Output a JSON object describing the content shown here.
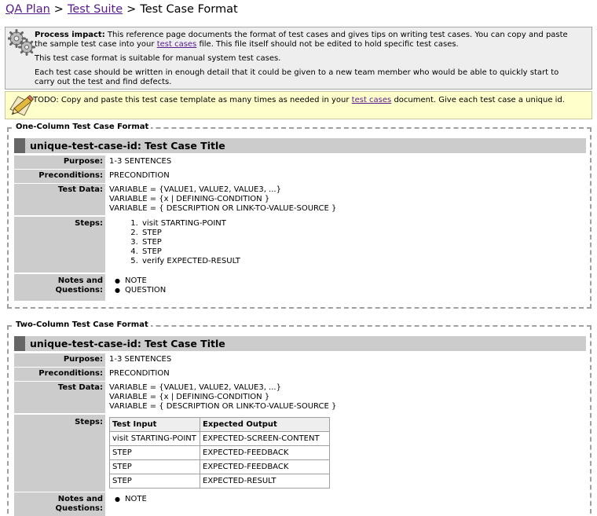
{
  "breadcrumb": {
    "link1": "QA Plan",
    "sep1": ">",
    "link2": "Test Suite",
    "sep2": ">",
    "current": "Test Case Format"
  },
  "impact": {
    "bold": "Process impact:",
    "text1": "This reference page documents the format of test cases and gives tips on writing test cases. You can copy and paste the sample test case into your",
    "link": "test cases",
    "text2": "file. This file itself should not be edited to hold specific test cases.",
    "para2": "This test case format is suitable for manual system test cases.",
    "para3": "Each test case should be written in enough detail that it could be given to a new team member who would be able to quickly start to carry out the test and find defects."
  },
  "todo": {
    "text1": "TODO: Copy and paste this test case template as many times as needed in your",
    "link": "test cases",
    "text2": "document. Give each test case a unique id."
  },
  "one_column": {
    "legend": "One-Column Test Case Format",
    "title": "unique-test-case-id: Test Case Title",
    "purpose_label": "Purpose:",
    "purpose": "1-3 SENTENCES",
    "preconditions_label": "Preconditions:",
    "preconditions": "PRECONDITION",
    "test_data_label": "Test Data:",
    "test_data": [
      "VARIABLE = {VALUE1, VALUE2, VALUE3, ...}",
      "VARIABLE = {x | DEFINING-CONDITION }",
      "VARIABLE = { DESCRIPTION OR LINK-TO-VALUE-SOURCE }"
    ],
    "steps_label": "Steps:",
    "steps": [
      "visit STARTING-POINT",
      "STEP",
      "STEP",
      "STEP",
      "verify EXPECTED-RESULT"
    ],
    "notes_label": "Notes and Questions:",
    "notes": [
      "NOTE",
      "QUESTION"
    ]
  },
  "two_column": {
    "legend": "Two-Column Test Case Format",
    "title": "unique-test-case-id: Test Case Title",
    "purpose_label": "Purpose:",
    "purpose": "1-3 SENTENCES",
    "preconditions_label": "Preconditions:",
    "preconditions": "PRECONDITION",
    "test_data_label": "Test Data:",
    "test_data": [
      "VARIABLE = {VALUE1, VALUE2, VALUE3, ...}",
      "VARIABLE = {x | DEFINING-CONDITION }",
      "VARIABLE = { DESCRIPTION OR LINK-TO-VALUE-SOURCE }"
    ],
    "steps_label": "Steps:",
    "steps_headers": [
      "Test Input",
      "Expected Output"
    ],
    "steps_rows": [
      [
        "visit STARTING-POINT",
        "EXPECTED-SCREEN-CONTENT"
      ],
      [
        "STEP",
        "EXPECTED-FEEDBACK"
      ],
      [
        "STEP",
        "EXPECTED-FEEDBACK"
      ],
      [
        "STEP",
        "EXPECTED-RESULT"
      ]
    ],
    "notes_label": "Notes and Questions:",
    "notes": [
      "NOTE"
    ]
  }
}
